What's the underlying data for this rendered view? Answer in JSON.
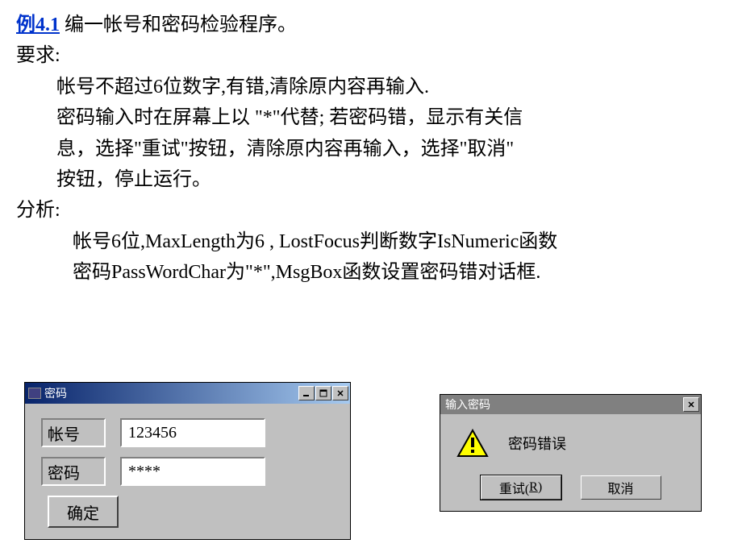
{
  "heading": {
    "example_link": "例4.1",
    "title_rest": "  编一帐号和密码检验程序。"
  },
  "req_label": "要求:",
  "req_line1": "帐号不超过6位数字,有错,清除原内容再输入.",
  "req_line2": "密码输入时在屏幕上以 \"*\"代替; 若密码错，显示有关信",
  "req_line3": "息，选择\"重试\"按钮，清除原内容再输入，选择\"取消\"",
  "req_line4": "按钮，停止运行。",
  "analysis_label": "分析:",
  "analysis_line1": "帐号6位,MaxLength为6 , LostFocus判断数字IsNumeric函数",
  "analysis_line2": "密码PassWordChar为\"*\",MsgBox函数设置密码错对话框.",
  "win1": {
    "title": "密码",
    "account_label": "帐号",
    "account_value": "123456",
    "password_label": "密码",
    "password_value": "****",
    "ok_button": "确定"
  },
  "win2": {
    "title": "输入密码",
    "message": "密码错误",
    "retry_prefix": "重试(",
    "retry_underline": "R",
    "retry_suffix": ")",
    "cancel": "取消"
  }
}
